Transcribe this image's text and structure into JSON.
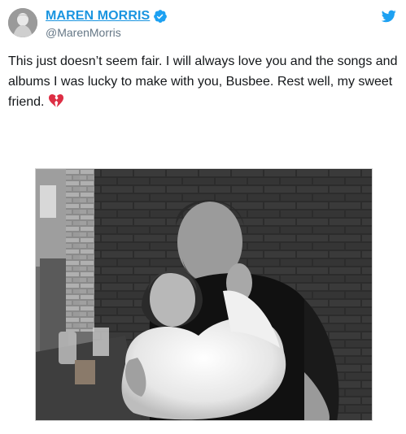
{
  "tweet": {
    "display_name": "MAREN MORRIS",
    "handle": "@MarenMorris",
    "text": "This just doesn’t seem fair. I will always love you and the songs and albums I was lucky to make with you, Busbee. Rest well, my sweet friend.",
    "emoji": "broken-heart-icon",
    "verified": true,
    "platform_icon": "twitter-bird-icon"
  },
  "colors": {
    "link_blue": "#1b95e0",
    "handle_gray": "#657786",
    "text": "#14171a",
    "heart_red": "#dd2e44"
  }
}
